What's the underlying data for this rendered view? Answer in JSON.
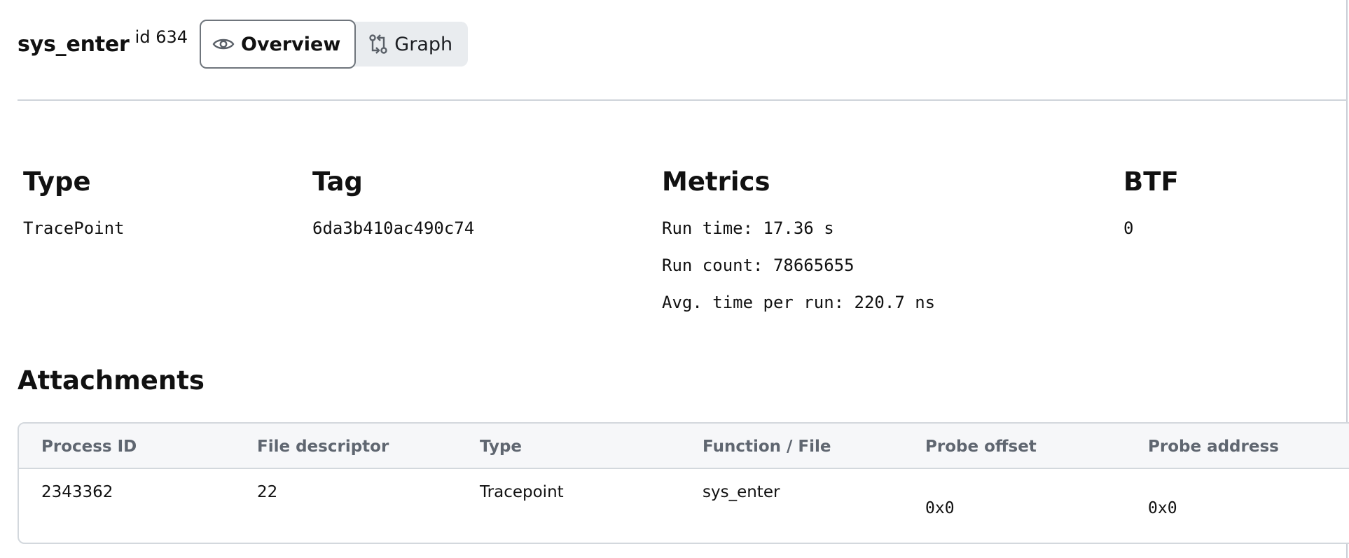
{
  "program": {
    "name": "sys_enter",
    "id_label": "id 634"
  },
  "tabs": [
    {
      "label": "Overview",
      "icon": "eye-icon",
      "active": true
    },
    {
      "label": "Graph",
      "icon": "git-compare-icon",
      "active": false
    }
  ],
  "info": {
    "type": {
      "heading": "Type",
      "value": "TracePoint"
    },
    "tag": {
      "heading": "Tag",
      "value": "6da3b410ac490c74"
    },
    "metrics": {
      "heading": "Metrics",
      "run_time": "Run time: 17.36 s",
      "run_count": "Run count: 78665655",
      "avg_time": "Avg. time per run: 220.7 ns"
    },
    "btf": {
      "heading": "BTF",
      "value": "0"
    }
  },
  "attachments": {
    "title": "Attachments",
    "columns": [
      "Process ID",
      "File descriptor",
      "Type",
      "Function / File",
      "Probe offset",
      "Probe address"
    ],
    "rows": [
      {
        "process_id": "2343362",
        "file_descriptor": "22",
        "type": "Tracepoint",
        "function_file": "sys_enter",
        "probe_offset": "0x0",
        "probe_address": "0x0"
      }
    ]
  },
  "colors": {
    "active_tab_border": "#6f757c",
    "tab_group_bg": "#e9ecef",
    "table_header_bg": "#f6f7f9",
    "table_header_text": "#5f6670"
  }
}
